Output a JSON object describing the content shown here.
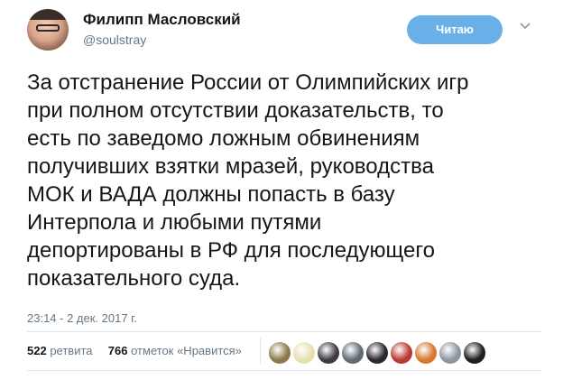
{
  "author": {
    "name": "Филипп Масловский",
    "handle": "@soulstray"
  },
  "follow_button": {
    "label": "Читаю"
  },
  "tweet": {
    "lines": [
      "За отстранение России от Олимпийских игр",
      "при полном отсутствии доказательств, то",
      "есть по заведомо ложным обвинениям",
      "получивших взятки мразей, руководства",
      "МОК и ВАДА должны попасть в базу",
      "Интерпола и любыми путями",
      "депортированы в РФ для последующего",
      "показательного суда."
    ],
    "timestamp": "23:14 - 2 дек. 2017 г."
  },
  "stats": {
    "retweets_count": "522",
    "retweets_label": "ретвита",
    "likes_count": "766",
    "likes_label": "отметок «Нравится»"
  },
  "colors": {
    "follow_button_bg": "#6ab0e8",
    "secondary_text": "#657786",
    "divider": "#e1e8ed"
  },
  "icons": {
    "more": "chevron-down-icon"
  },
  "likers": [
    {
      "name": "liker-avatar-1",
      "color": "#8a7a4a"
    },
    {
      "name": "liker-avatar-2",
      "color": "#e6e0b0"
    },
    {
      "name": "liker-avatar-3",
      "color": "#3c3a44"
    },
    {
      "name": "liker-avatar-4",
      "color": "#5f6a72"
    },
    {
      "name": "liker-avatar-5",
      "color": "#2a2730"
    },
    {
      "name": "liker-avatar-6",
      "color": "#b93a34"
    },
    {
      "name": "liker-avatar-7",
      "color": "#d7782c"
    },
    {
      "name": "liker-avatar-8",
      "color": "#8c96a0"
    },
    {
      "name": "liker-avatar-9",
      "color": "#1d1d1d"
    }
  ]
}
